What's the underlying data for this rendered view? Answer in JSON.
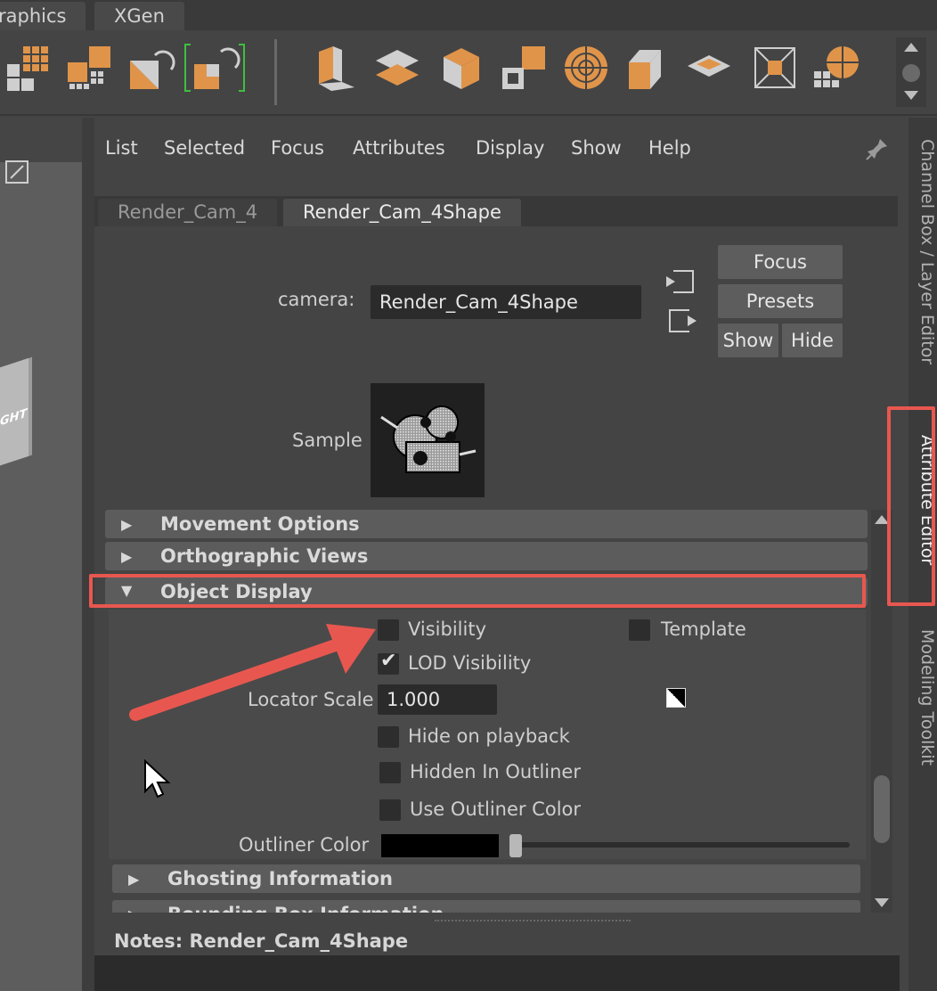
{
  "shelf_tabs": [
    "raphics",
    "XGen"
  ],
  "ae_menu": [
    "List",
    "Selected",
    "Focus",
    "Attributes",
    "Display",
    "Show",
    "Help"
  ],
  "ae_tabs": [
    {
      "label": "Render_Cam_4",
      "active": false
    },
    {
      "label": "Render_Cam_4Shape",
      "active": true
    }
  ],
  "camera": {
    "label": "camera:",
    "value": "Render_Cam_4Shape"
  },
  "buttons": {
    "focus": "Focus",
    "presets": "Presets",
    "show": "Show",
    "hide": "Hide"
  },
  "sample_label": "Sample",
  "sections": {
    "movement": {
      "title": "Movement Options",
      "expanded": false
    },
    "ortho": {
      "title": "Orthographic Views",
      "expanded": false
    },
    "object_display": {
      "title": "Object Display",
      "expanded": true
    },
    "ghosting": {
      "title": "Ghosting Information",
      "expanded": false
    },
    "bounding": {
      "title": "Bounding Box Information",
      "expanded": false
    }
  },
  "object_display": {
    "visibility": {
      "label": "Visibility",
      "checked": false
    },
    "template": {
      "label": "Template",
      "checked": false
    },
    "lod_visibility": {
      "label": "LOD Visibility",
      "checked": true
    },
    "locator_scale": {
      "label": "Locator Scale",
      "value": "1.000"
    },
    "hide_on_playback": {
      "label": "Hide on playback",
      "checked": false
    },
    "hidden_in_outliner": {
      "label": "Hidden In Outliner",
      "checked": false
    },
    "use_outliner_color": {
      "label": "Use Outliner Color",
      "checked": false
    },
    "outliner_color": {
      "label": "Outliner Color",
      "color": "#000000"
    }
  },
  "notes": {
    "label": "Notes:  Render_Cam_4Shape"
  },
  "side_tabs": {
    "channel_box": "Channel Box / Layer Editor",
    "attribute_editor": "Attribute Editor",
    "modeling_toolkit": "Modeling Toolkit"
  },
  "viewcube_label": "GHT",
  "colors": {
    "accent_orange": "#e0944a",
    "highlight_red": "#e8574f",
    "panel": "#444444"
  }
}
